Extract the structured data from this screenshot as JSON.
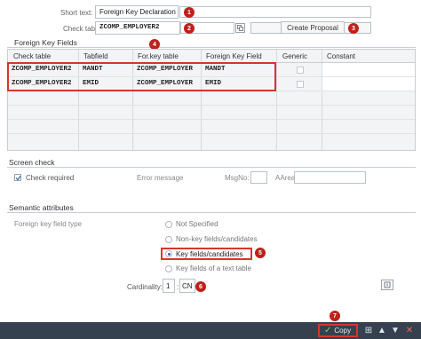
{
  "header": {
    "short_text_label": "Short text:",
    "short_text_value": "Foreign Key Declaration",
    "check_table_label": "Check table:",
    "check_table_value": "ZCOMP_EMPLOYER2",
    "create_proposal_label": "Create Proposal"
  },
  "fk_fields": {
    "title": "Foreign Key Fields",
    "columns": [
      "Check table",
      "Tabfield",
      "For.key table",
      "Foreign Key Field",
      "Generic",
      "Constant"
    ],
    "rows": [
      {
        "check_table": "ZCOMP_EMPLOYER2",
        "tabfield": "MANDT",
        "fk_table": "ZCOMP_EMPLOYER",
        "fk_field": "MANDT"
      },
      {
        "check_table": "ZCOMP_EMPLOYER2",
        "tabfield": "EMID",
        "fk_table": "ZCOMP_EMPLOYER",
        "fk_field": "EMID"
      }
    ]
  },
  "screen_check": {
    "title": "Screen check",
    "check_required_label": "Check required",
    "check_required": true,
    "error_message_label": "Error message",
    "msgno_label": "MsgNo:",
    "msgno_value": "",
    "aarea_label": "AArea:",
    "aarea_value": ""
  },
  "semantic": {
    "title": "Semantic attributes",
    "fk_field_type_label": "Foreign key field type",
    "options": [
      "Not Specified",
      "Non-key fields/candidates",
      "Key fields/candidates",
      "Key fields of a text table"
    ],
    "selected_index": 2,
    "cardinality_label": "Cardinality:",
    "cardinality_left": "1",
    "cardinality_right": "CN"
  },
  "footer": {
    "copy_label": "Copy"
  },
  "badges": [
    "1",
    "2",
    "3",
    "4",
    "5",
    "6",
    "7"
  ],
  "colors": {
    "highlight": "#d9342b",
    "badge": "#c0201a",
    "footer_bg": "#35414e",
    "table_bg": "#f2f4f5"
  },
  "icons": [
    "match-code-icon",
    "checkbox-checked-icon",
    "info-icon",
    "checkmark-icon",
    "hierarchy-icon",
    "up-icon",
    "down-icon",
    "close-icon"
  ]
}
